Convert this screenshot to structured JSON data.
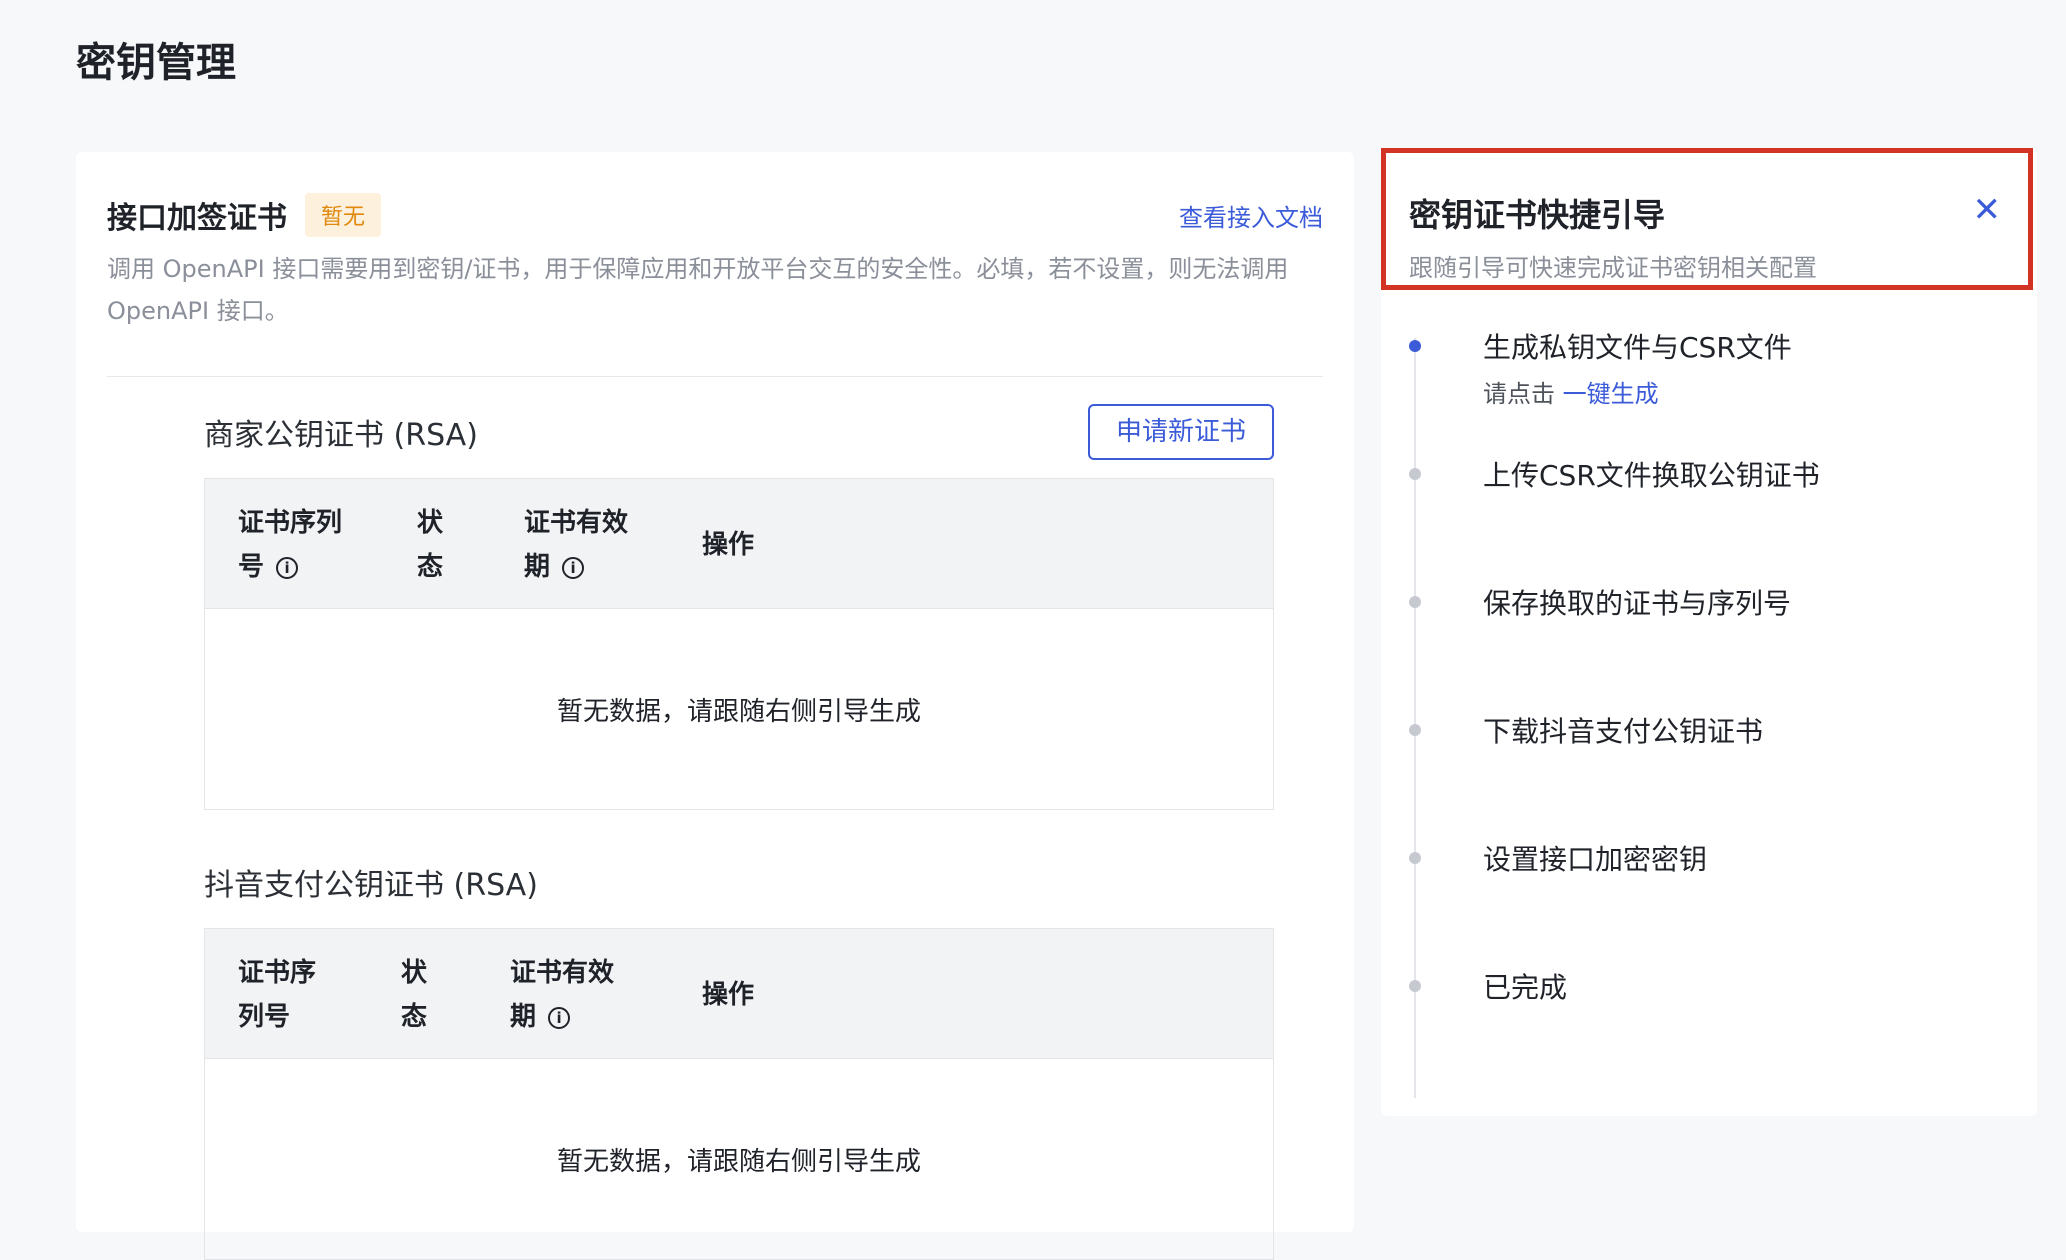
{
  "page": {
    "title": "密钥管理"
  },
  "main": {
    "title": "接口加签证书",
    "badge": "暂无",
    "doc_link": "查看接入文档",
    "description": "调用 OpenAPI 接口需要用到密钥/证书，用于保障应用和开放平台交互的安全性。必填，若不设置，则无法调用 OpenAPI 接口。",
    "sections": [
      {
        "title": "商家公钥证书 (RSA)",
        "apply_button": "申请新证书",
        "columns": [
          "证书序列号",
          "状态",
          "证书有效期",
          "操作"
        ],
        "col_line1": [
          "证书序列",
          "状",
          "证书有效",
          "操作"
        ],
        "col_line2": [
          "号",
          "态",
          "期",
          ""
        ],
        "empty_text": "暂无数据，请跟随右侧引导生成"
      },
      {
        "title": "抖音支付公钥证书 (RSA)",
        "columns": [
          "证书序列号",
          "状态",
          "证书有效期",
          "操作"
        ],
        "col_line1": [
          "证书序",
          "状",
          "证书有效",
          "操作"
        ],
        "col_line2": [
          "列号",
          "态",
          "期",
          ""
        ],
        "empty_text": "暂无数据，请跟随右侧引导生成"
      }
    ],
    "info_glyph": "i"
  },
  "guide": {
    "title": "密钥证书快捷引导",
    "subtitle": "跟随引导可快速完成证书密钥相关配置",
    "close_glyph": "✕",
    "steps": [
      {
        "label": "生成私钥文件与CSR文件",
        "hint_prefix": "请点击",
        "hint_link": "一键生成",
        "active": true
      },
      {
        "label": "上传CSR文件换取公钥证书"
      },
      {
        "label": "保存换取的证书与序列号"
      },
      {
        "label": "下载抖音支付公钥证书"
      },
      {
        "label": "设置接口加密密钥"
      },
      {
        "label": "已完成"
      }
    ]
  }
}
